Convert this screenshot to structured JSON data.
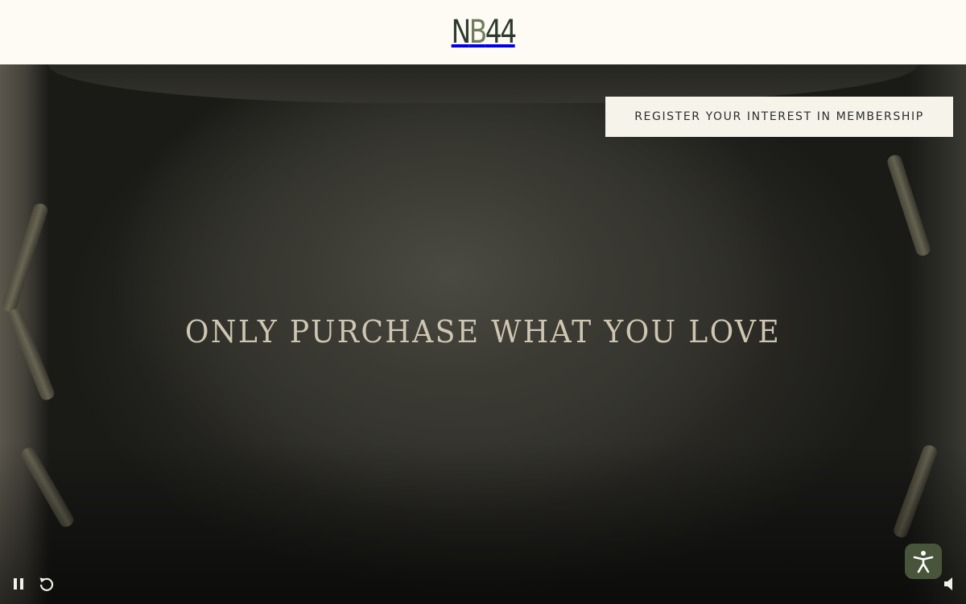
{
  "header": {
    "logo": {
      "letters": [
        "N",
        "B",
        "44"
      ],
      "colors": {
        "primary": "#2b3a2c",
        "accent": "#6e7d59"
      }
    }
  },
  "hero": {
    "cta_label": "REGISTER YOUR INTEREST IN MEMBERSHIP",
    "headline": "ONLY PURCHASE WHAT YOU LOVE"
  },
  "video_controls": {
    "pause_icon": "pause-icon",
    "replay_icon": "replay-icon",
    "volume_icon": "volume-icon"
  },
  "accessibility": {
    "icon": "accessibility-person-icon",
    "color": "#48553a"
  },
  "colors": {
    "background": "#fdfbf4",
    "headline": "#cfc6b2",
    "button_bg": "#f5f3ea"
  }
}
